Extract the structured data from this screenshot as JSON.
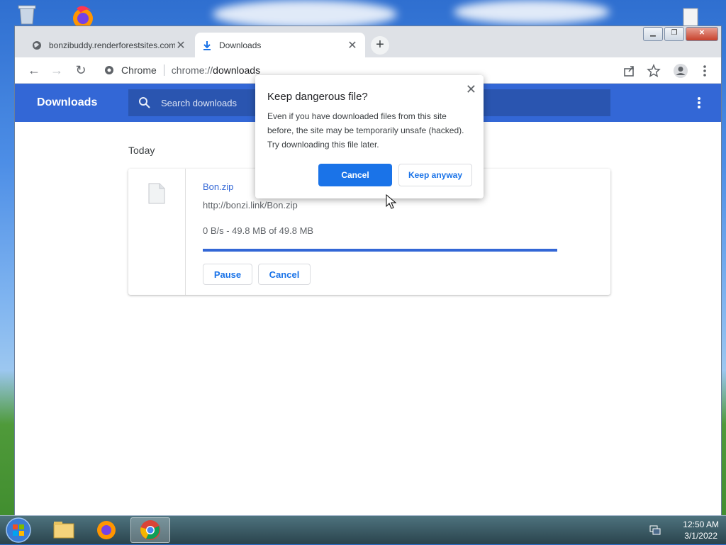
{
  "tabs": [
    {
      "label": "bonzibuddy.renderforestsites.com"
    },
    {
      "label": "Downloads"
    }
  ],
  "toolbar": {
    "omni_label": "Chrome",
    "url_prefix": "chrome://",
    "url_path": "downloads"
  },
  "downloads": {
    "title": "Downloads",
    "search_placeholder": "Search downloads",
    "section": "Today",
    "item": {
      "filename": "Bon.zip",
      "url": "http://bonzi.link/Bon.zip",
      "progress_text": "0 B/s - 49.8 MB of 49.8 MB",
      "progress_fraction": 1.0,
      "pause_label": "Pause",
      "cancel_label": "Cancel"
    }
  },
  "dialog": {
    "title": "Keep dangerous file?",
    "body": "Even if you have downloaded files from this site before, the site may be temporarily unsafe (hacked). Try downloading this file later.",
    "cancel_label": "Cancel",
    "keep_label": "Keep anyway"
  },
  "taskbar": {
    "time": "12:50 AM",
    "date": "3/1/2022"
  },
  "colors": {
    "accent": "#1a73e8",
    "header": "#3367d6"
  }
}
